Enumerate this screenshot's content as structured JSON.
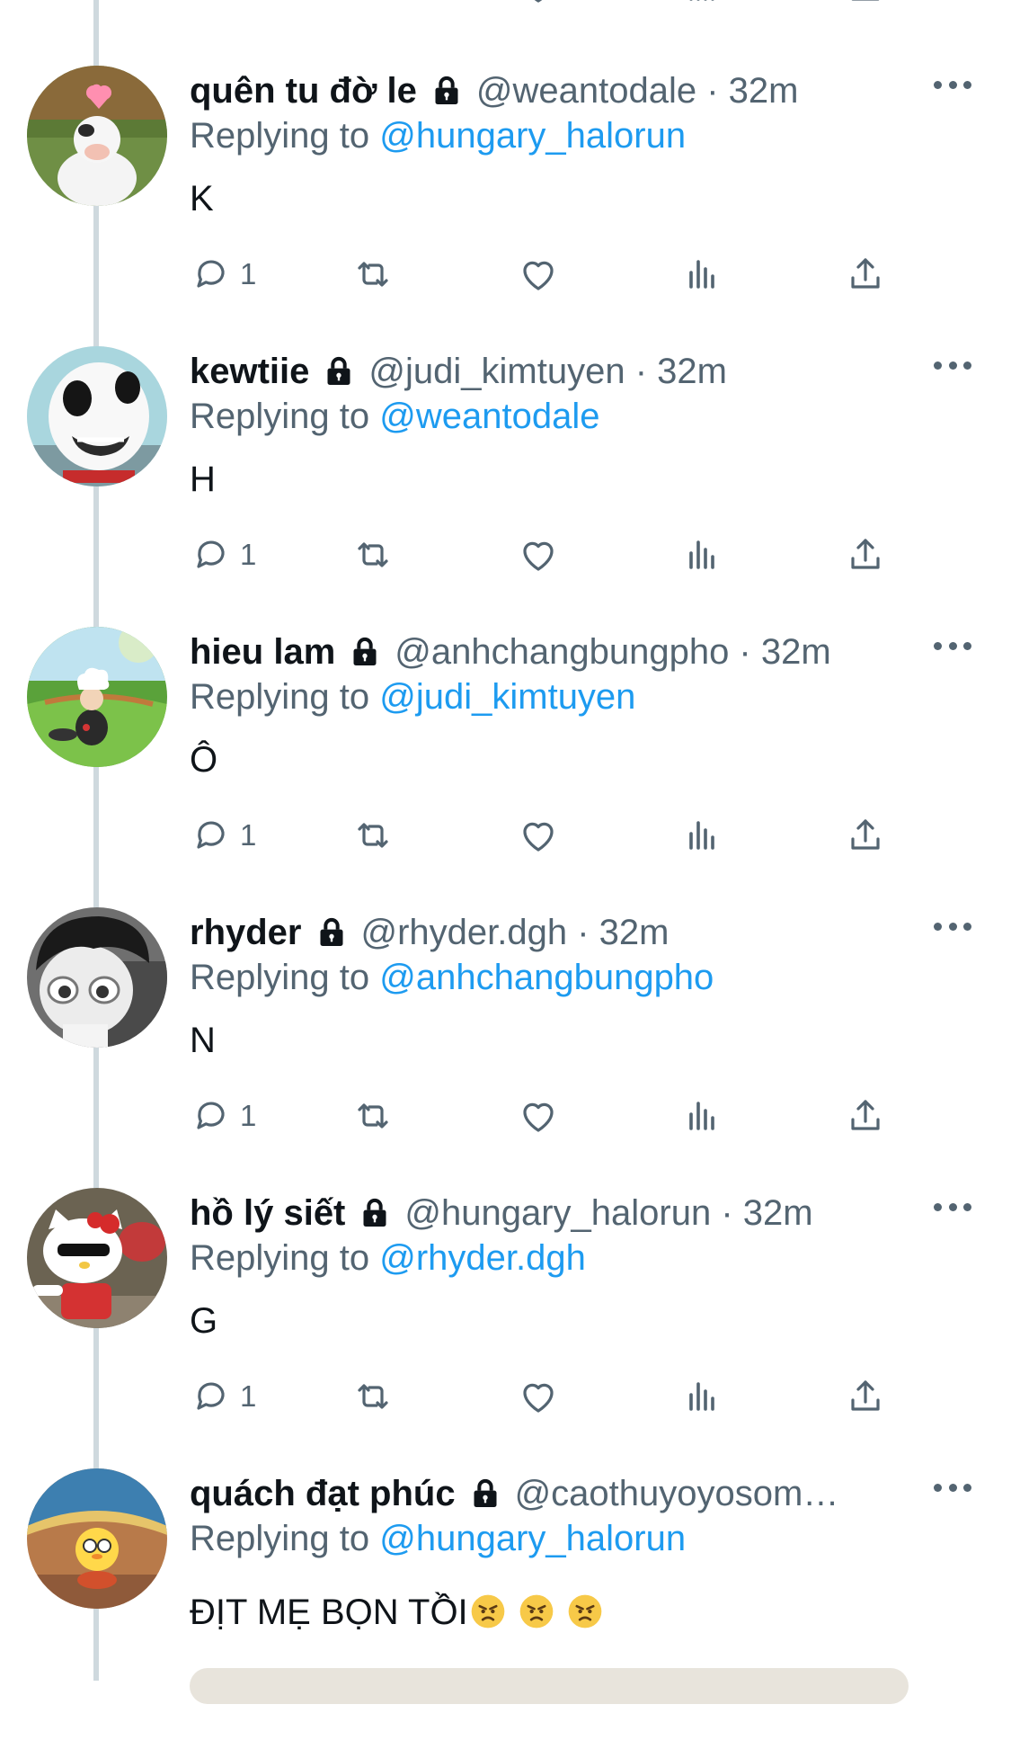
{
  "tweets": [
    {
      "name": "quên tu đờ le",
      "handle_time": "@weantodale · 32m",
      "replying_label": "Replying to",
      "replying_to": "@hungary_halorun",
      "text": "K",
      "reply_count": "1",
      "avatar": "cow-avatar"
    },
    {
      "name": "kewtiie",
      "handle_time": "@judi_kimtuyen · 32m",
      "replying_label": "Replying to",
      "replying_to": "@weantodale",
      "text": "H",
      "reply_count": "1",
      "avatar": "white-creature-avatar"
    },
    {
      "name": "hieu lam",
      "handle_time": "@anhchangbungpho · 32m",
      "replying_label": "Replying to",
      "replying_to": "@judi_kimtuyen",
      "text": "Ô",
      "reply_count": "1",
      "avatar": "chef-avatar"
    },
    {
      "name": "rhyder",
      "handle_time": "@rhyder.dgh · 32m",
      "replying_label": "Replying to",
      "replying_to": "@anhchangbungpho",
      "text": "N",
      "reply_count": "1",
      "avatar": "doll-avatar"
    },
    {
      "name": "hồ lý siết",
      "handle_time": "@hungary_halorun · 32m",
      "replying_label": "Replying to",
      "replying_to": "@rhyder.dgh",
      "text": "G",
      "reply_count": "1",
      "avatar": "hello-kitty-avatar"
    },
    {
      "name": "quách đạt phúc",
      "handle_time": "@caothuyoyosomo…",
      "replying_label": "Replying to",
      "replying_to": "@hungary_halorun",
      "text": "ĐỊT MẸ BỌN TỒI",
      "emojis": [
        "angry-face",
        "angry-face",
        "angry-face"
      ],
      "avatar": "tweety-avatar"
    }
  ],
  "colors": {
    "text": "#0f1419",
    "secondary": "#536471",
    "link": "#1d9bf0",
    "thread_line": "#cfd9de"
  },
  "icons": [
    "reply-icon",
    "retweet-icon",
    "like-icon",
    "views-icon",
    "share-icon",
    "lock-icon",
    "more-icon"
  ]
}
